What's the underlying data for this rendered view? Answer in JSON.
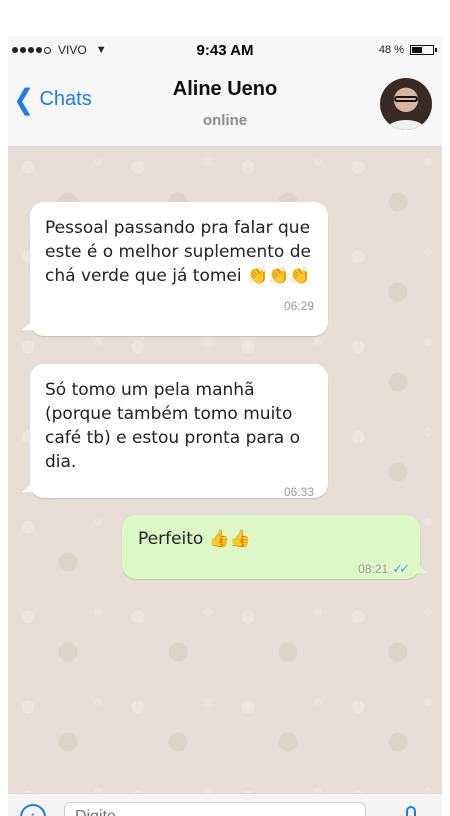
{
  "status_bar": {
    "carrier": "VIVO",
    "time": "9:43 AM",
    "battery_percent": "48 %",
    "wifi_icon": "wifi-icon",
    "battery_level": 0.48
  },
  "nav": {
    "back_label": "Chats",
    "contact_name": "Aline Ueno",
    "contact_status": "online",
    "avatar_icon": "avatar-photo"
  },
  "messages": [
    {
      "direction": "incoming",
      "text": "Pessoal passando pra falar que este é o melhor suplemento de chá verde que já tomei 👏👏👏",
      "time": "06:29"
    },
    {
      "direction": "incoming",
      "text": "Só tomo um pela manhã (porque também tomo muito café tb) e estou pronta para o dia.",
      "time": "06:33"
    },
    {
      "direction": "outgoing",
      "text": "Perfeito 👍👍",
      "time": "08:21",
      "read_receipt": "double-check-icon"
    }
  ],
  "input": {
    "placeholder": "Digite",
    "attach_icon": "plus-circle-icon",
    "mic_icon": "mic-icon"
  },
  "colors": {
    "accent": "#1a7cf5",
    "chat_background": "#e6ded4",
    "incoming_bubble": "#ffffff",
    "outgoing_bubble": "#dcf8c6",
    "read_tick": "#4aa3e6"
  }
}
